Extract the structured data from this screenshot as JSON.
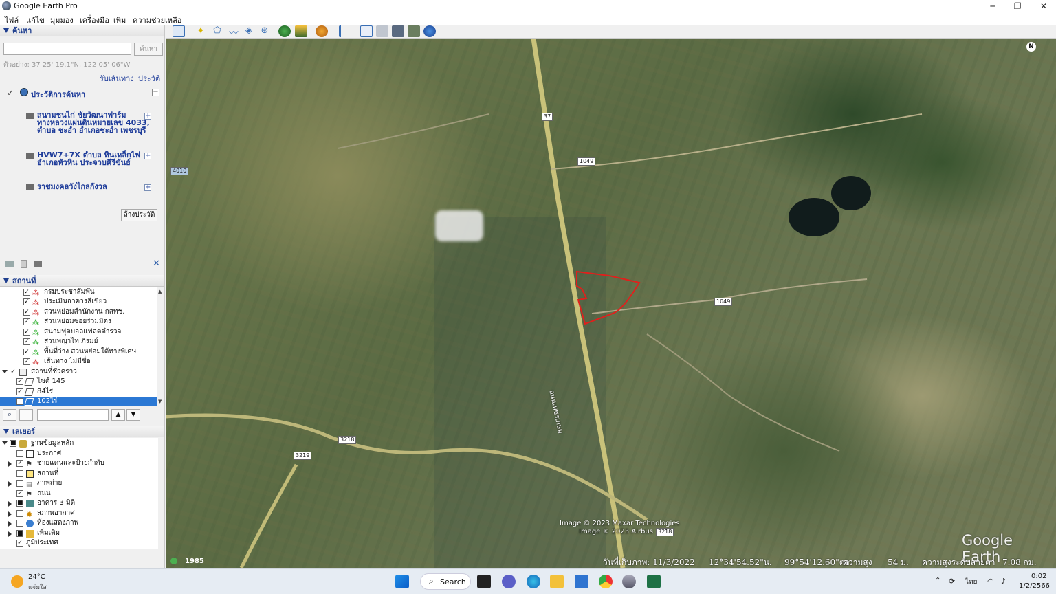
{
  "window": {
    "title": "Google Earth Pro",
    "minimize": "─",
    "maximize": "❐",
    "close": "✕"
  },
  "menu": [
    "ไฟล์",
    "แก้ไข",
    "มุมมอง",
    "เครื่องมือ",
    "เพิ่ม",
    "ความช่วยเหลือ"
  ],
  "search_panel": {
    "header": "ค้นหา",
    "input_value": "",
    "search_button": "ค้นหา",
    "hint": "ตัวอย่าง: 37 25' 19.1\"N, 122 05' 06\"W",
    "directions_link": "รับเส้นทาง",
    "history_link": "ประวัติ",
    "history_title": "ประวัติการค้นหา",
    "results": [
      {
        "line1": "สนามชนไก่ ชัยวัฒนาฟาร์ม",
        "line2": "ทางหลวงแผ่นดินหมายเลข 4033,",
        "line3": "ตำบล ชะอำ อำเภอชะอำ เพชรบุรี"
      },
      {
        "line1": "HVW7+7X ตำบล หินเหล็กไฟ",
        "line2": "อำเภอหัวหิน ประจวบคีรีขันธ์"
      },
      {
        "line1": "ราชมงคลวังไกลกังวล"
      }
    ],
    "clear_button": "ล้างประวัติ"
  },
  "places_panel": {
    "header": "สถานที่",
    "items": [
      {
        "label": "กรมประชาสัมพัน",
        "checked": true
      },
      {
        "label": "ประเมินอาคารสีเขียว",
        "checked": true
      },
      {
        "label": "สวนหย่อมสำนักงาน กสทช.",
        "checked": true
      },
      {
        "label": "สวนหย่อมซอยร่วมมิตร",
        "checked": true
      },
      {
        "label": "สนามฟุตบอลแฟลตตำรวจ",
        "checked": true
      },
      {
        "label": "สวนพญาไท ภิรมย์",
        "checked": true
      },
      {
        "label": "พื้นที่ว่าง สวนหย่อมใต้ทางพิเศษ",
        "checked": true
      },
      {
        "label": "เส้นทาง ไม่มีชื่อ",
        "checked": true
      },
      {
        "label": "สถานที่ชั่วคราว",
        "checked": true
      },
      {
        "label": "ไซต์ 145",
        "checked": true
      },
      {
        "label": "84ไร่",
        "checked": true
      },
      {
        "label": "102ไร่",
        "checked": true
      }
    ],
    "filter_value": ""
  },
  "layers_panel": {
    "header": "เลเยอร์",
    "items": [
      {
        "label": "ฐานข้อมูลหลัก",
        "checked": true
      },
      {
        "label": "ประกาศ",
        "checked": false
      },
      {
        "label": "ชายแดนและป้ายกำกับ",
        "checked": true
      },
      {
        "label": "สถานที่",
        "checked": false
      },
      {
        "label": "ภาพถ่าย",
        "checked": false
      },
      {
        "label": "ถนน",
        "checked": true
      },
      {
        "label": "อาคาร 3 มิติ",
        "checked": false
      },
      {
        "label": "สภาพอากาศ",
        "checked": false
      },
      {
        "label": "ห้องแสดงภาพ",
        "checked": false
      },
      {
        "label": "เพิ่มเติม",
        "checked": false
      },
      {
        "label": "ภูมิประเทศ",
        "checked": true
      }
    ]
  },
  "map": {
    "road_labels": [
      "37",
      "1049",
      "4010",
      "1049",
      "3218",
      "3219",
      "3218"
    ],
    "road_name": "ถนนเพชรเกษม",
    "north": "N",
    "attribution1": "Image © 2023 Maxar Technologies",
    "attribution2": "Image © 2023 Airbus",
    "logo": "Google Earth",
    "year": "1985",
    "status": {
      "date": "วันที่เก็บภาพ: 11/3/2022",
      "lat": "12°34'54.52\"น.",
      "lon": "99°54'12.60\"ตอ.",
      "elev_label": "ความสูง",
      "elev": "54 ม.",
      "eye_label": "ความสูงระดับสายตา",
      "eye": "7.08 กม."
    },
    "polygon_color": "#e0201c"
  },
  "taskbar": {
    "temperature": "24°C",
    "weather": "แจ่มใส",
    "search": "Search",
    "language": "ไทย",
    "time": "0:02",
    "date": "1/2/2566"
  }
}
